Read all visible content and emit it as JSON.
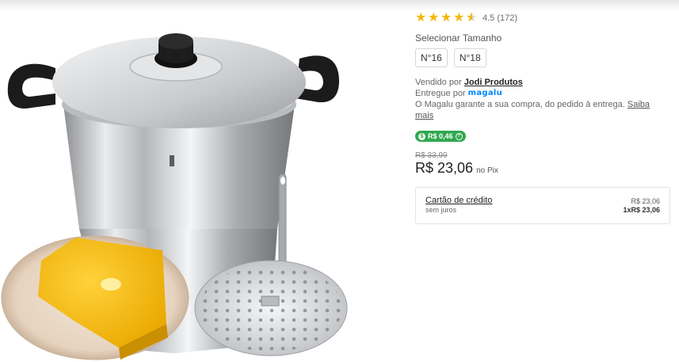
{
  "rating": {
    "value": 4.5,
    "text": "4.5 (172)",
    "star_color": "#f0b90b"
  },
  "size": {
    "title": "Selecionar Tamanho",
    "options": [
      "N°16",
      "N°18"
    ]
  },
  "seller": {
    "sold_prefix": "Vendido por",
    "seller_name": "Jodi Produtos",
    "delivered_prefix": "Entregue por",
    "delivered_brand": "magalu",
    "guarantee_text": "O Magalu garante a sua compra, do pedido à entrega.",
    "guarantee_link": "Saiba mais"
  },
  "cashback": {
    "label": "R$ 0,46",
    "color": "#2fa84f"
  },
  "price": {
    "old": "R$ 33,99",
    "current": "R$ 23,06",
    "suffix": "no Pix"
  },
  "card_payment": {
    "title": "Cartão de crédito",
    "subtitle": "sem juros",
    "total": "R$ 23,06",
    "installment": "1xR$ 23,06"
  },
  "icons": {
    "cashback": "coin-icon",
    "info": "info-icon"
  }
}
